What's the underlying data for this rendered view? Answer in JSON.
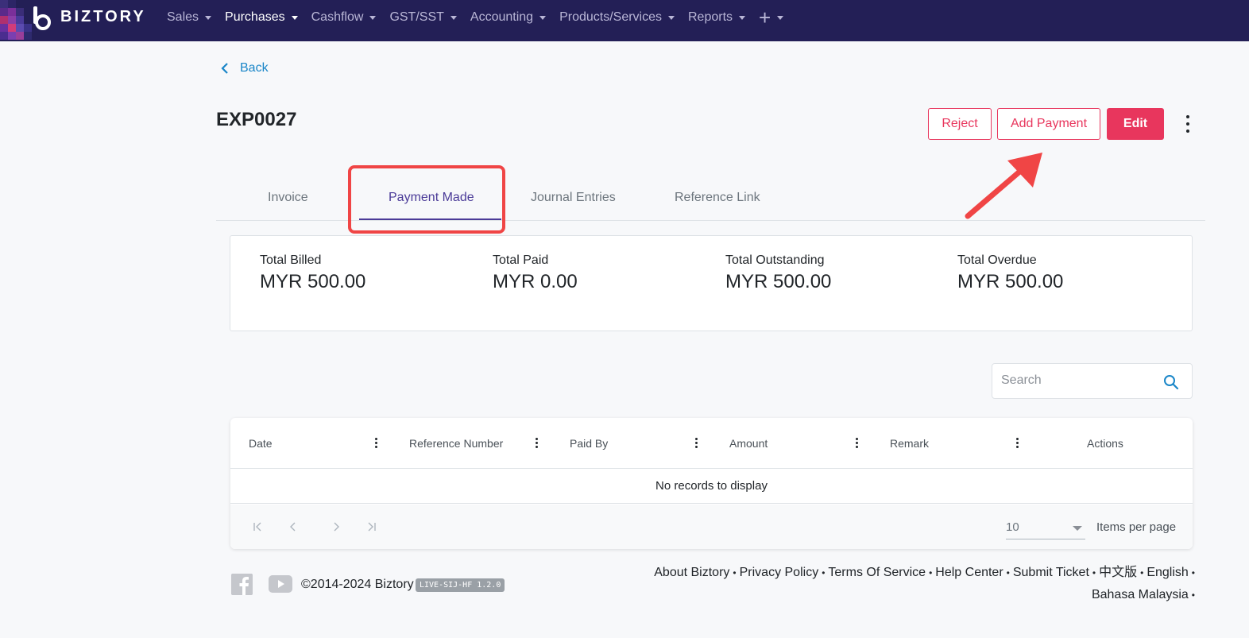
{
  "brand": {
    "name": "BIZTORY"
  },
  "nav": {
    "items": [
      {
        "label": "Sales"
      },
      {
        "label": "Purchases"
      },
      {
        "label": "Cashflow"
      },
      {
        "label": "GST/SST"
      },
      {
        "label": "Accounting"
      },
      {
        "label": "Products/Services"
      },
      {
        "label": "Reports"
      }
    ],
    "active": "Purchases",
    "plus_icon": "plus-icon"
  },
  "back": {
    "label": "Back"
  },
  "document": {
    "id": "EXP0027"
  },
  "actions": {
    "reject": "Reject",
    "add_payment": "Add Payment",
    "edit": "Edit"
  },
  "tabs": [
    {
      "label": "Invoice"
    },
    {
      "label": "Payment Made"
    },
    {
      "label": "Journal Entries"
    },
    {
      "label": "Reference Link"
    }
  ],
  "active_tab": "Payment Made",
  "summary": [
    {
      "label": "Total Billed",
      "value": "MYR 500.00"
    },
    {
      "label": "Total Paid",
      "value": "MYR 0.00"
    },
    {
      "label": "Total Outstanding",
      "value": "MYR 500.00"
    },
    {
      "label": "Total Overdue",
      "value": "MYR 500.00"
    }
  ],
  "search": {
    "placeholder": "Search"
  },
  "grid": {
    "columns": [
      "Date",
      "Reference Number",
      "Paid By",
      "Amount",
      "Remark",
      "Actions"
    ],
    "empty_text": "No records to display",
    "page_size": "10",
    "page_size_label": "Items per page"
  },
  "footer": {
    "copyright": "©2014-2024 Biztory",
    "build": "LIVE-SIJ-HF 1.2.0",
    "links": [
      "About Biztory",
      "Privacy Policy",
      "Terms Of Service",
      "Help Center",
      "Submit Ticket",
      "中文版",
      "English",
      "Bahasa Malaysia"
    ]
  },
  "colors": {
    "nav_bg": "#231f56",
    "accent": "#e8365d",
    "tab_active": "#4b3b98",
    "link": "#1a86c8",
    "annotation": "#f04545"
  }
}
